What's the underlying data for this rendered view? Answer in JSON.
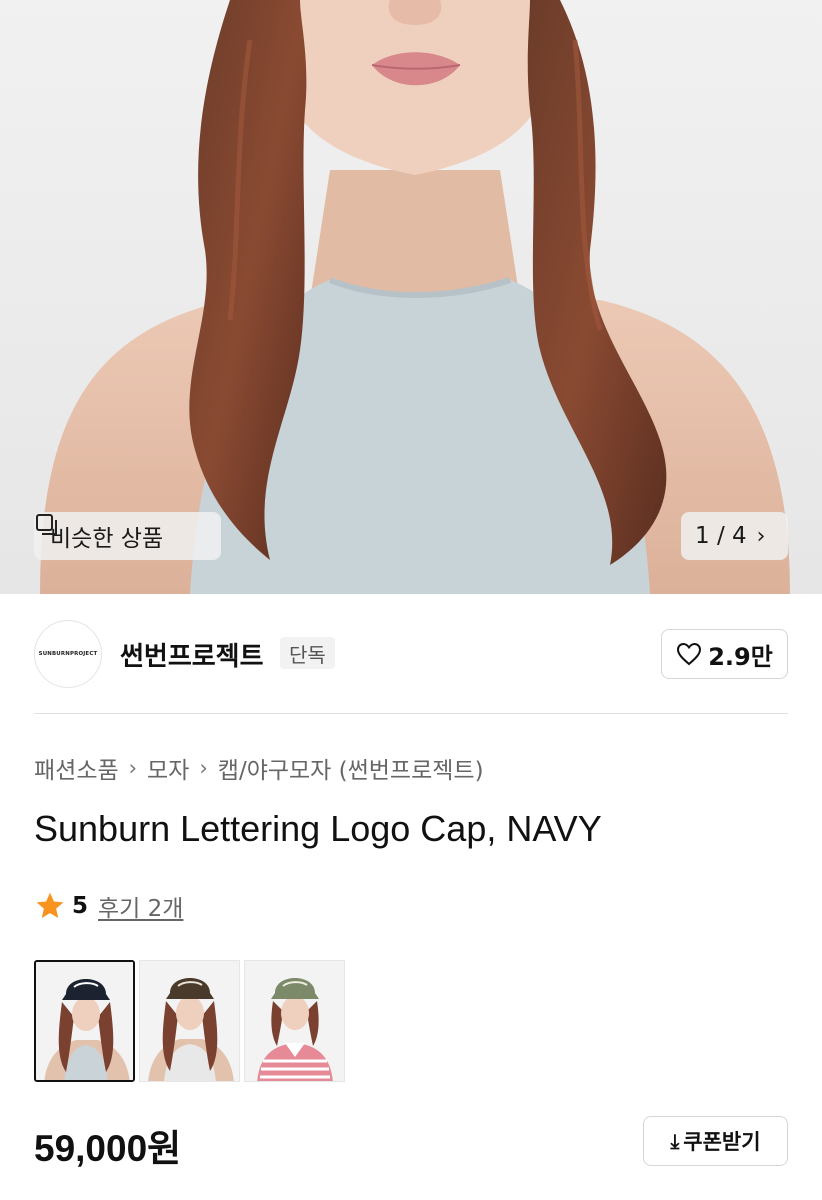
{
  "hero": {
    "similar_label": "비슷한 상품",
    "counter": "1 / 4",
    "icons": {
      "similar": "similar-items-icon",
      "next": "chevron-right-icon"
    }
  },
  "store": {
    "logo_text": "SUNBURNPROJECT",
    "name": "썬번프로젝트",
    "badge": "단독",
    "likes": "2.9만",
    "icons": {
      "like": "heart-icon"
    }
  },
  "breadcrumb": [
    "패션소품",
    "모자",
    "캡/야구모자 (썬번프로젝트)"
  ],
  "product": {
    "title": "Sunburn Lettering Logo Cap, NAVY",
    "rating": "5",
    "reviews": "후기 2개",
    "price": "59,000원",
    "coupon_label": "쿠폰받기"
  },
  "thumbnails": [
    {
      "label": "navy",
      "cap_color": "#1c2230",
      "shirt_color": "#c9d3d8",
      "selected": true
    },
    {
      "label": "brown",
      "cap_color": "#4a3a2c",
      "shirt_color": "#e8e8e8",
      "selected": false
    },
    {
      "label": "khaki",
      "cap_color": "#7d8a6a",
      "shirt_color": "#e68a97",
      "selected": false
    }
  ],
  "colors": {
    "star": "#f7931e",
    "background": "#ffffff",
    "hero_bg": "#ececec"
  }
}
